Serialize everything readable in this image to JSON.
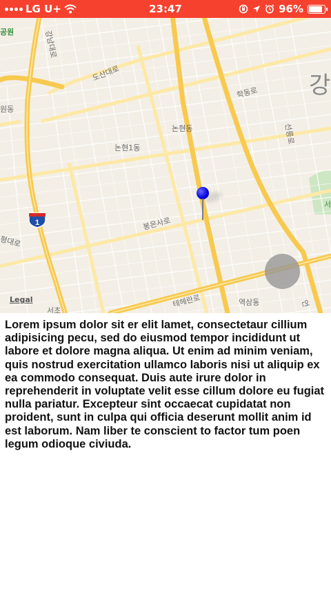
{
  "status_bar": {
    "carrier": "LG U+",
    "time": "23:47",
    "battery_percent": "96%",
    "battery_level": 0.96,
    "background_color": "#f7412f",
    "icons": [
      "signal-dots-icon",
      "wifi-icon",
      "rotation-lock-icon",
      "location-arrow-icon",
      "alarm-icon",
      "battery-icon"
    ]
  },
  "map": {
    "labels": {
      "park": "공원",
      "gangnam_daero": "강남대로",
      "dosan_daero": "도산대로",
      "hakdong_ro": "학동로",
      "gang": "강",
      "wondong": "원동",
      "nonhyeon_dong": "논현동",
      "nonhyeon_1dong": "논현1동",
      "seonreung_ro": "선릉로",
      "bongeun_sa_ro": "봉은사로",
      "pyeong_daero": "평대로",
      "teheran_ro": "테헤란로",
      "yeoksam_dong": "역삼동",
      "seocho": "서초",
      "eon": "언",
      "green_s": "서"
    },
    "highway_shield": "1",
    "legal": "Legal",
    "colors": {
      "land": "#f3efe6",
      "major_road": "#f8c94f",
      "secondary_road": "#fde9a6",
      "minor_road": "#ffffff",
      "park": "#cde6c3",
      "pin": "#0000e0"
    }
  },
  "content": {
    "paragraph": "Lorem ipsum dolor sit er elit lamet, consectetaur cillium adipisicing pecu, sed do eiusmod tempor incididunt ut labore et dolore magna aliqua. Ut enim ad minim veniam, quis nostrud exercitation ullamco laboris nisi ut aliquip ex ea commodo consequat. Duis aute irure dolor in reprehenderit in voluptate velit esse cillum dolore eu fugiat nulla pariatur. Excepteur sint occaecat cupidatat non proident, sunt in culpa qui officia deserunt mollit anim id est laborum. Nam liber te conscient to factor tum poen legum odioque civiuda."
  }
}
